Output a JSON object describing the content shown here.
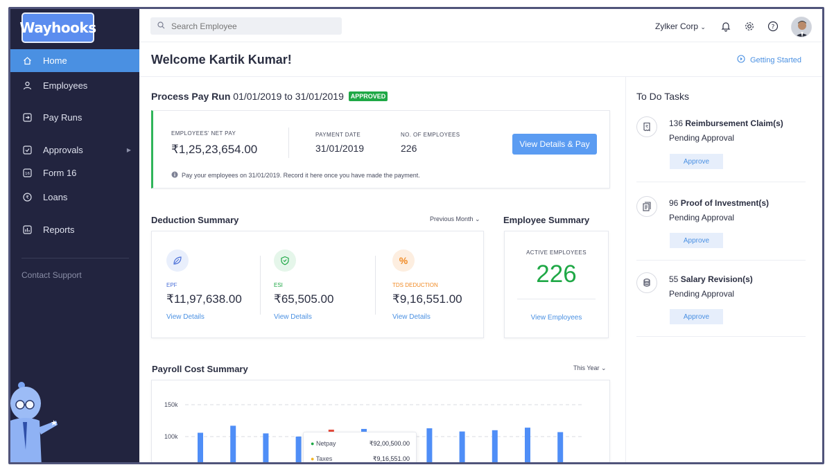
{
  "brand": {
    "logo_text": "Wayhooks",
    "accent": "#4a90e2",
    "sidebar_bg": "#22243f",
    "success": "#1fa846"
  },
  "sidebar": {
    "items": [
      {
        "label": "Home",
        "icon": "home-icon",
        "active": true
      },
      {
        "label": "Employees",
        "icon": "person-icon"
      },
      {
        "label": "Pay Runs",
        "icon": "arrow-in-box-icon"
      },
      {
        "label": "Approvals",
        "icon": "checkbox-icon",
        "has_submenu": true
      },
      {
        "label": "Form 16",
        "icon": "form16-icon"
      },
      {
        "label": "Loans",
        "icon": "rupee-circle-icon"
      },
      {
        "label": "Reports",
        "icon": "bar-chart-icon"
      }
    ],
    "contact_support": "Contact Support"
  },
  "topbar": {
    "search_placeholder": "Search Employee",
    "company": "Zylker Corp",
    "icons": [
      "bell-icon",
      "gear-icon",
      "help-icon",
      "avatar"
    ]
  },
  "header": {
    "welcome": "Welcome Kartik Kumar!",
    "getting_started": "Getting Started"
  },
  "payrun": {
    "title": "Process Pay Run",
    "period": "01/01/2019 to 31/01/2019",
    "status": "APPROVED",
    "net_pay_label": "EMPLOYEES' NET PAY",
    "net_pay": "₹1,25,23,654.00",
    "payment_date_label": "PAYMENT DATE",
    "payment_date": "31/01/2019",
    "employees_label": "NO. OF EMPLOYEES",
    "employees": "226",
    "button": "View Details & Pay",
    "note": "Pay your employees on 31/01/2019. Record it here once you have made the payment."
  },
  "deduction": {
    "title": "Deduction Summary",
    "filter": "Previous Month",
    "items": [
      {
        "label": "EPF",
        "amount": "₹11,97,638.00",
        "link": "View Details",
        "color": "#4a6fd8",
        "bg": "#e9effc",
        "icon": "leaf-icon"
      },
      {
        "label": "ESI",
        "amount": "₹65,505.00",
        "link": "View Details",
        "color": "#1fa846",
        "bg": "#e5f6ea",
        "icon": "shield-icon"
      },
      {
        "label": "TDS DEDUCTION",
        "amount": "₹9,16,551.00",
        "link": "View Details",
        "color": "#f08a24",
        "bg": "#fdeee0",
        "icon": "percent-icon",
        "symbol": "%"
      }
    ]
  },
  "employee_summary": {
    "title": "Employee Summary",
    "label": "ACTIVE EMPLOYEES",
    "count": "226",
    "link": "View Employees"
  },
  "payroll": {
    "title": "Payroll Cost Summary",
    "filter": "This Year",
    "tooltip": [
      {
        "label": "Netpay",
        "value": "₹92,00,500.00",
        "color": "#1fa846"
      },
      {
        "label": "Taxes",
        "value": "₹9,16,551.00",
        "color": "#f5b623"
      }
    ]
  },
  "chart_data": {
    "type": "bar",
    "yticks": [
      "150k",
      "100k"
    ],
    "ylim": [
      0,
      150000
    ],
    "values": [
      106000,
      117000,
      105000,
      100000,
      0,
      112000,
      106000,
      113000,
      108000,
      110000,
      114000,
      107000
    ],
    "colors": {
      "bar": "#4f8ef7",
      "stack": [
        "#e54b3c",
        "#f5b623",
        "#1fa846"
      ]
    }
  },
  "todo": {
    "title": "To Do Tasks",
    "approve_label": "Approve",
    "tasks": [
      {
        "count": "136",
        "name": "Reimbursement Claim(s)",
        "status": "Pending Approval",
        "icon": "rupee-receipt-icon"
      },
      {
        "count": "96",
        "name": "Proof of Investment(s)",
        "status": "Pending Approval",
        "icon": "documents-icon"
      },
      {
        "count": "55",
        "name": "Salary Revision(s)",
        "status": "Pending Approval",
        "icon": "coins-icon"
      }
    ]
  }
}
